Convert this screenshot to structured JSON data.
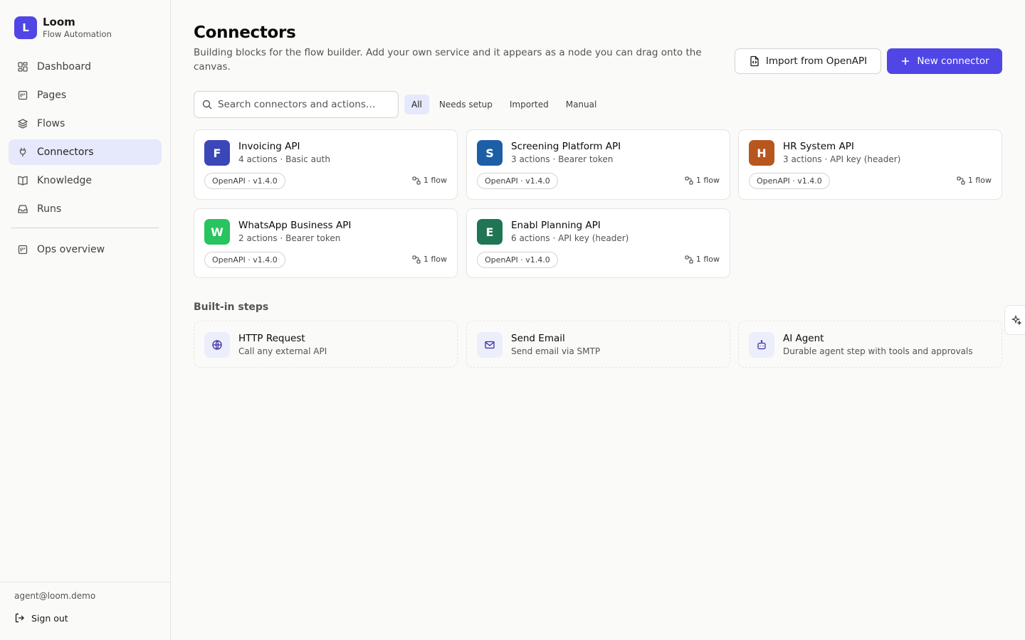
{
  "brand": {
    "letter": "L",
    "name": "Loom",
    "subtitle": "Flow Automation"
  },
  "sidebar": {
    "items": [
      {
        "label": "Dashboard",
        "icon": "dashboard-icon"
      },
      {
        "label": "Pages",
        "icon": "pages-icon"
      },
      {
        "label": "Flows",
        "icon": "layers-icon"
      },
      {
        "label": "Connectors",
        "icon": "plug-icon",
        "active": true
      },
      {
        "label": "Knowledge",
        "icon": "book-icon"
      },
      {
        "label": "Runs",
        "icon": "inbox-icon"
      }
    ],
    "secondary": [
      {
        "label": "Ops overview",
        "icon": "pages-icon"
      }
    ],
    "user_email": "agent@loom.demo",
    "sign_out": "Sign out"
  },
  "header": {
    "title": "Connectors",
    "description": "Building blocks for the flow builder. Add your own service and it appears as a node you can drag onto the canvas.",
    "import_button": "Import from OpenAPI",
    "new_button": "New connector"
  },
  "search": {
    "placeholder": "Search connectors and actions…",
    "value": ""
  },
  "filters": [
    {
      "label": "All",
      "active": true
    },
    {
      "label": "Needs setup"
    },
    {
      "label": "Imported"
    },
    {
      "label": "Manual"
    }
  ],
  "connectors": [
    {
      "letter": "F",
      "name": "Invoicing API",
      "meta": "4 actions · Basic auth",
      "badge": "OpenAPI · v1.4.0",
      "flows": "1 flow",
      "color": "#3b46b8"
    },
    {
      "letter": "S",
      "name": "Screening Platform API",
      "meta": "3 actions · Bearer token",
      "badge": "OpenAPI · v1.4.0",
      "flows": "1 flow",
      "color": "#1d5fa6"
    },
    {
      "letter": "H",
      "name": "HR System API",
      "meta": "3 actions · API key (header)",
      "badge": "OpenAPI · v1.4.0",
      "flows": "1 flow",
      "color": "#b8561f"
    },
    {
      "letter": "W",
      "name": "WhatsApp Business API",
      "meta": "2 actions · Bearer token",
      "badge": "OpenAPI · v1.4.0",
      "flows": "1 flow",
      "color": "#27c45f"
    },
    {
      "letter": "E",
      "name": "Enabl Planning API",
      "meta": "6 actions · API key (header)",
      "badge": "OpenAPI · v1.4.0",
      "flows": "1 flow",
      "color": "#1f7554"
    }
  ],
  "builtin": {
    "title": "Built-in steps",
    "steps": [
      {
        "name": "HTTP Request",
        "desc": "Call any external API",
        "icon": "globe-icon"
      },
      {
        "name": "Send Email",
        "desc": "Send email via SMTP",
        "icon": "mail-icon"
      },
      {
        "name": "AI Agent",
        "desc": "Durable agent step with tools and approvals",
        "icon": "bot-icon"
      }
    ]
  },
  "colors": {
    "accent": "#5046e5",
    "active_bg": "#e6e9fb",
    "border": "#e7e5e4"
  }
}
